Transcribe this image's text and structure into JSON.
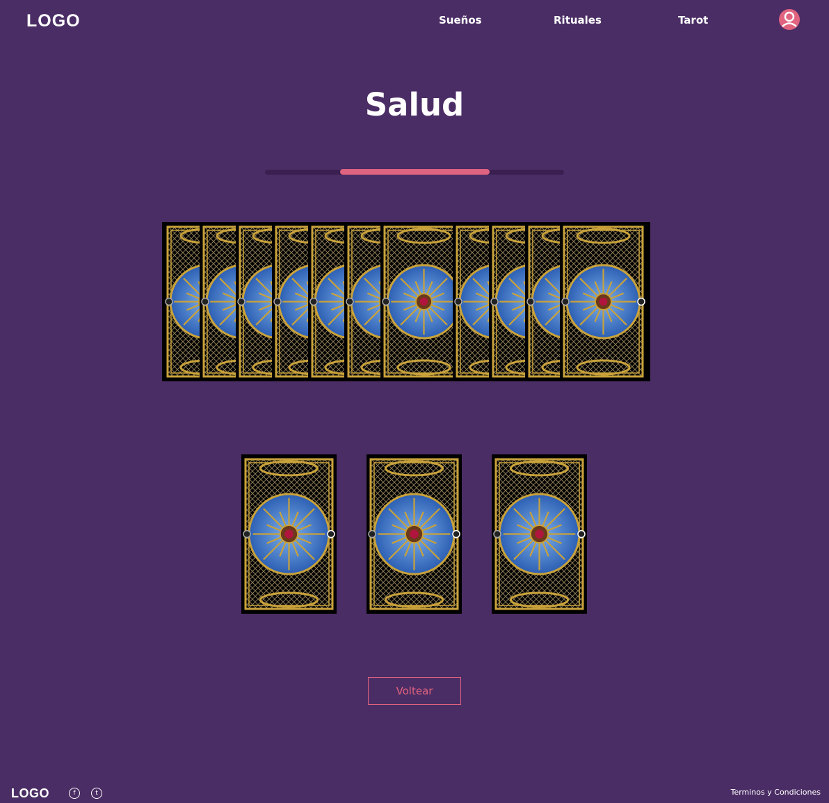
{
  "header": {
    "logo": "LOGO",
    "nav": [
      {
        "label": "Sueños"
      },
      {
        "label": "Rituales"
      },
      {
        "label": "Tarot"
      }
    ],
    "profile_icon": "user-circle-icon"
  },
  "main": {
    "title": "Salud",
    "progress": 0.5,
    "deck": {
      "card_count": 11,
      "card_back_icon": "tarot-card-back-icon"
    },
    "spread": {
      "card_count": 3
    },
    "flip_button_label": "Voltear"
  },
  "footer": {
    "logo": "LOGO",
    "social": [
      {
        "icon": "facebook-icon",
        "glyph": "f"
      },
      {
        "icon": "twitter-icon",
        "glyph": "t"
      }
    ],
    "terms_label": "Terminos y Condiciones"
  },
  "colors": {
    "background": "#4b2d65",
    "accent": "#e0637f",
    "card_gold": "#c9a23a",
    "card_blue": "#2c5fb3"
  }
}
